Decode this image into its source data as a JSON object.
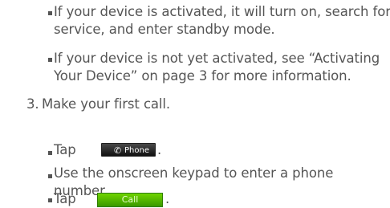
{
  "bullets": {
    "b1_l1": "If your device is activated, it will turn on, search for",
    "b1_l2": "service, and enter standby mode.",
    "b2_l1": "If your device is not yet activated, see “Activating",
    "b2_l2": "Your Device” on page 3 for more information."
  },
  "step3": {
    "number": "3.",
    "text": "Make your first call.",
    "tap1": "Tap",
    "tap1_end": ".",
    "keypad_l1": "Use the onscreen keypad to enter a phone",
    "keypad_l2": "number.",
    "tap2": "Tap",
    "tap2_end": "."
  },
  "buttons": {
    "phone_label": "Phone",
    "phone_icon": "phone-handset-icon",
    "call_label": "Call"
  },
  "colors": {
    "text": "#555555",
    "phone_button": "#1e1e1e",
    "call_button": "#4caf00"
  }
}
